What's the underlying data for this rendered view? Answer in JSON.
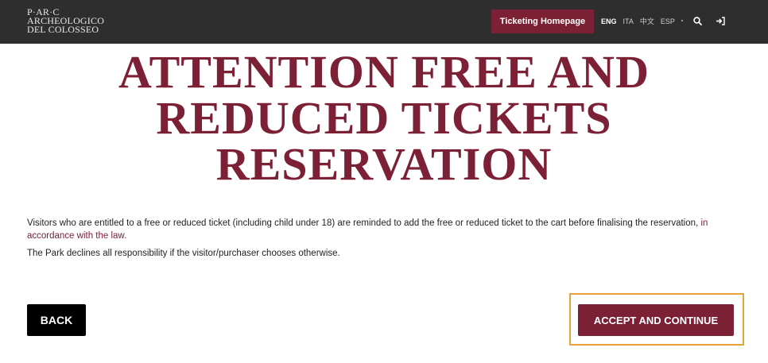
{
  "header": {
    "logo_lines": [
      "P·AR·C",
      "ARCHEOLOGICO",
      "DEL COLOSSEO"
    ],
    "ticketing_button": "Ticketing Homepage",
    "languages": [
      "ENG",
      "ITA",
      "中文",
      "ESP"
    ],
    "active_language": "ENG",
    "search_icon": "search-icon",
    "login_icon": "sign-in-icon"
  },
  "main": {
    "title_lines": [
      "ATTENTION FREE AND",
      "REDUCED TICKETS",
      "RESERVATION"
    ],
    "paragraph1": "Visitors who are entitled to a free or reduced ticket (including child under 18) are reminded to add the free or reduced ticket to the cart before finalising the reservation, ",
    "paragraph1_link": "in accordance with the law.",
    "paragraph2": "The Park declines all responsibility if the visitor/purchaser chooses otherwise."
  },
  "actions": {
    "back_label": "BACK",
    "accept_label": "ACCEPT AND CONTINUE"
  },
  "colors": {
    "brand": "#7b2035",
    "header_bg": "#2e2e2e",
    "highlight": "#e8a23a"
  }
}
